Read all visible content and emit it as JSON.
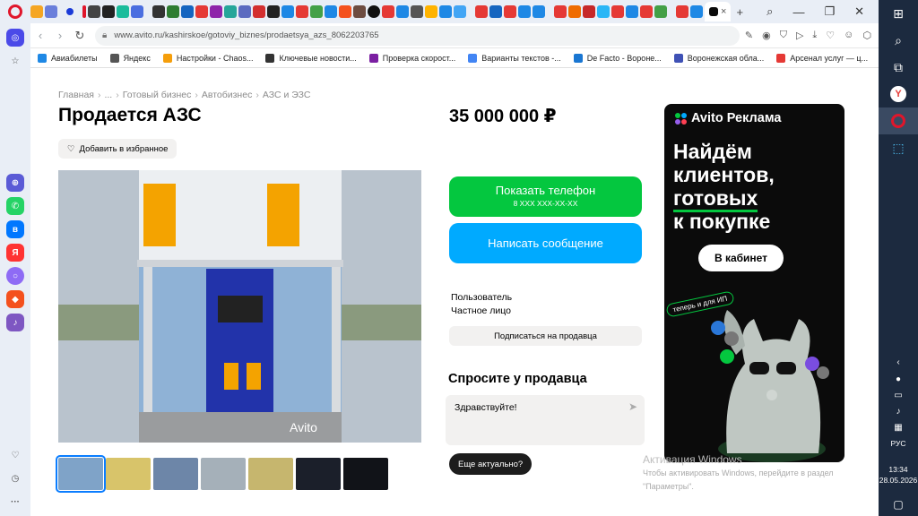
{
  "browser": {
    "url": "www.avito.ru/kashirskoe/gotoviy_biznes/prodaetsya_azs_8062203765",
    "bookmarks": [
      {
        "label": "Авиабилеты",
        "color": "#1e88e5"
      },
      {
        "label": "Яндекс",
        "color": "#555555"
      },
      {
        "label": "Настройки - Chaos...",
        "color": "#f59e0b"
      },
      {
        "label": "Ключевые новости...",
        "color": "#333333"
      },
      {
        "label": "Проверка скорост...",
        "color": "#7b1fa2"
      },
      {
        "label": "Варианты текстов -...",
        "color": "#4285f4"
      },
      {
        "label": "De Facto - Вороне...",
        "color": "#1976d2"
      },
      {
        "label": "Воронежская обла...",
        "color": "#3f51b5"
      },
      {
        "label": "Арсенал услуг — ц...",
        "color": "#e53935"
      }
    ],
    "more_bookmarks": "»"
  },
  "breadcrumb": [
    "Главная",
    "...",
    "Готовый бизнес",
    "Автобизнес",
    "АЗС и ЭЗС"
  ],
  "listing": {
    "title": "Продается АЗС",
    "favorite_label": "Добавить в избранное",
    "price": "35 000 000 ₽",
    "thumbs_count": 7
  },
  "contact": {
    "phone_button": "Показать телефон",
    "phone_mask": "8 XXX XXX-XX-XX",
    "message_button": "Написать сообщение",
    "seller_name": "Пользователь",
    "seller_type": "Частное лицо",
    "subscribe_button": "Подписаться на продавца"
  },
  "ask": {
    "title": "Спросите у продавца",
    "message_value": "Здравствуйте!",
    "quick_reply": "Еще актуально?"
  },
  "ad": {
    "brand": "Avito Реклама",
    "headline_1": "Найдём",
    "headline_2": "клиентов,",
    "headline_3": "готовых",
    "headline_4": "к покупке",
    "cta": "В кабинет",
    "tag": "теперь и для ИП"
  },
  "photo_watermark": "Avito",
  "windows": {
    "activation_title": "Активация Windows",
    "activation_text_1": "Чтобы активировать Windows, перейдите в раздел",
    "activation_text_2": "\"Параметры\".",
    "lang": "РУС",
    "time": "13:34",
    "date": "28.05.2026"
  }
}
